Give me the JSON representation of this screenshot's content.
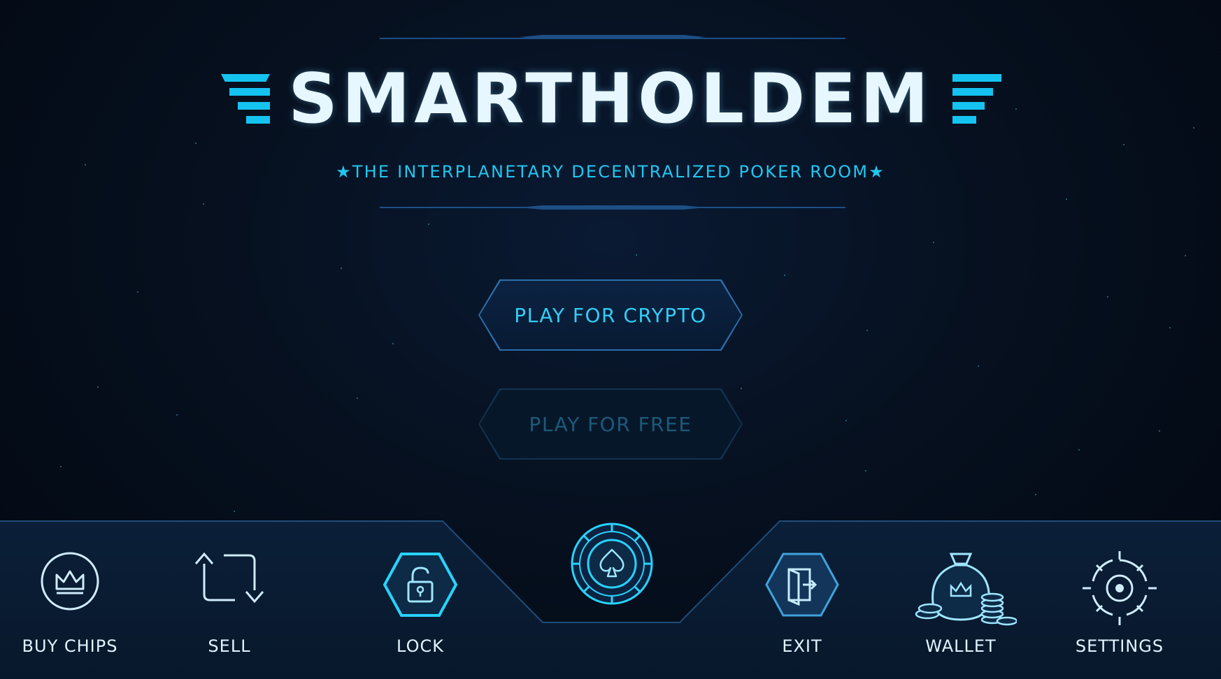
{
  "header": {
    "title": "SMARTHOLDEM",
    "tagline": "★THE INTERPLANETARY DECENTRALIZED POKER ROOM★"
  },
  "menu": {
    "play_crypto_label": "PLAY FOR CRYPTO",
    "play_free_label": "PLAY FOR FREE"
  },
  "bottom_nav": {
    "items": [
      {
        "label": "BUY CHIPS",
        "icon": "crown-circle-icon"
      },
      {
        "label": "SELL",
        "icon": "swap-arrows-icon"
      },
      {
        "label": "LOCK",
        "icon": "padlock-icon"
      },
      {
        "label": "EXIT",
        "icon": "exit-door-icon"
      },
      {
        "label": "WALLET",
        "icon": "money-bag-icon"
      },
      {
        "label": "SETTINGS",
        "icon": "target-gear-icon"
      }
    ],
    "center_icon": "spade-chip-icon"
  },
  "colors": {
    "accent": "#15c3f0",
    "background": "#030811",
    "text": "#dff5ff",
    "panel_border": "#1e4d79"
  }
}
